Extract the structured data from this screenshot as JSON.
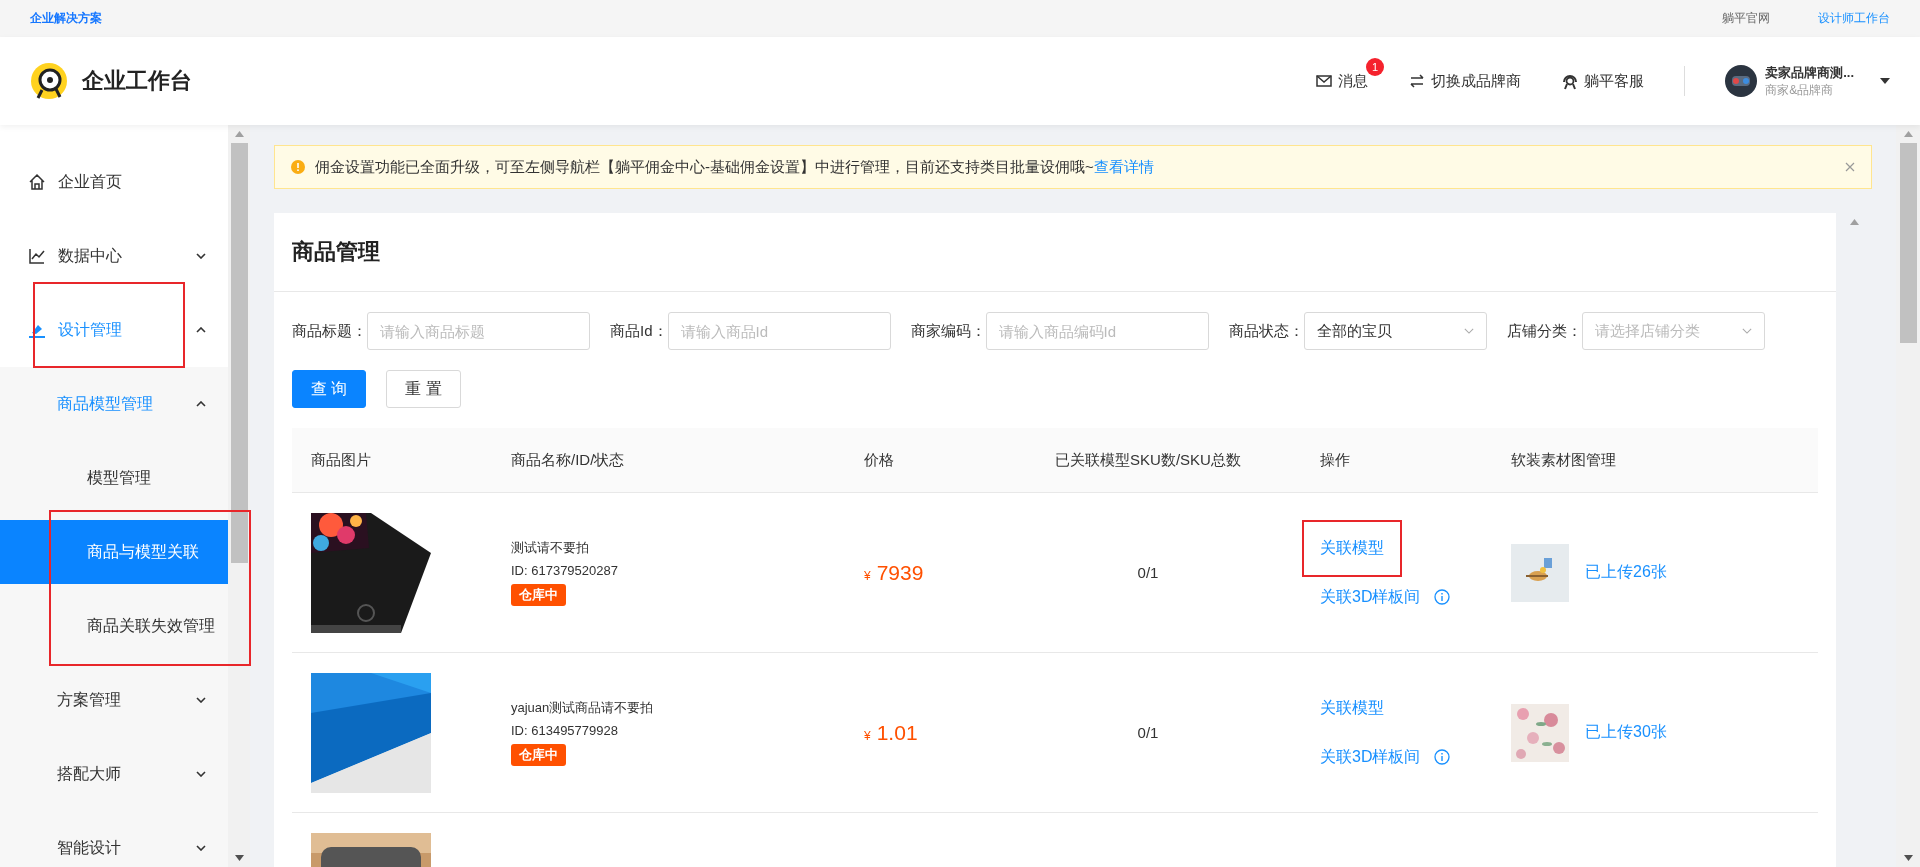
{
  "top_bar": {
    "brand_link": "企业解决方案",
    "links": [
      "躺平官网",
      "设计师工作台"
    ]
  },
  "header": {
    "logo_text": "企业工作台",
    "nav": [
      {
        "kind": "messages",
        "label": "消息",
        "badge": "1"
      },
      {
        "kind": "switch",
        "label": "切换成品牌商"
      },
      {
        "kind": "service",
        "label": "躺平客服"
      }
    ],
    "user": {
      "name": "卖家品牌商测...",
      "role": "商家&品牌商"
    }
  },
  "sidebar": {
    "items": [
      {
        "label": "企业首页",
        "selected": false
      },
      {
        "label": "数据中心",
        "expanded": false,
        "selected": false
      },
      {
        "label": "设计管理",
        "expanded": true,
        "selected": false,
        "highlighted": true,
        "children": [
          {
            "label": "商品模型管理",
            "expanded": true,
            "selected": false,
            "children": [
              {
                "label": "模型管理",
                "selected": false
              },
              {
                "label": "商品与模型关联",
                "selected": true,
                "highlighted": true
              },
              {
                "label": "商品关联失效管理",
                "selected": false,
                "highlighted": true
              }
            ]
          },
          {
            "label": "方案管理",
            "expanded": false,
            "selected": false
          },
          {
            "label": "搭配大师",
            "expanded": false,
            "selected": false
          },
          {
            "label": "智能设计",
            "expanded": false,
            "selected": false
          }
        ]
      }
    ]
  },
  "notice": {
    "text": "佣金设置功能已全面升级，可至左侧导航栏【躺平佣金中心-基础佣金设置】中进行管理，目前还支持类目批量设佣哦~",
    "link": "查看详情"
  },
  "page_title": "商品管理",
  "filters": [
    {
      "kind": "input",
      "label": "商品标题：",
      "placeholder": "请输入商品标题"
    },
    {
      "kind": "input",
      "label": "商品Id：",
      "placeholder": "请输入商品Id"
    },
    {
      "kind": "input",
      "label": "商家编码：",
      "placeholder": "请输入商品编码Id"
    },
    {
      "kind": "select",
      "label": "商品状态：",
      "value": "全部的宝贝"
    },
    {
      "kind": "select",
      "label": "店铺分类：",
      "placeholder": "请选择店铺分类"
    }
  ],
  "buttons": [
    {
      "kind": "primary",
      "label": "查 询"
    },
    {
      "kind": "default",
      "label": "重 置"
    }
  ],
  "table": {
    "columns": [
      "商品图片",
      "商品名称/ID/状态",
      "价格",
      "已关联模型SKU数/SKU总数",
      "操作",
      "软装素材图管理"
    ],
    "rows": [
      {
        "image": {
          "kind": "picture"
        },
        "name": "测试请不要拍",
        "id": "ID: 617379520287",
        "status": "仓库中",
        "currency": "¥",
        "price": "7939",
        "sku": "0/1",
        "actions": [
          {
            "kind": "link",
            "label": "关联模型",
            "highlighted": true
          },
          {
            "kind": "link_info",
            "label": "关联3D样板间"
          }
        ],
        "material": {
          "kind": "picture",
          "label": "已上传26张"
        }
      },
      {
        "image": {
          "kind": "picture"
        },
        "name": "yajuan测试商品请不要拍",
        "id": "ID: 613495779928",
        "status": "仓库中",
        "currency": "¥",
        "price": "1.01",
        "sku": "0/1",
        "actions": [
          {
            "kind": "link",
            "label": "关联模型"
          },
          {
            "kind": "link_info",
            "label": "关联3D样板间"
          }
        ],
        "material": {
          "kind": "picture",
          "label": "已上传30张"
        }
      },
      {
        "image": {
          "kind": "picture"
        }
      }
    ]
  }
}
